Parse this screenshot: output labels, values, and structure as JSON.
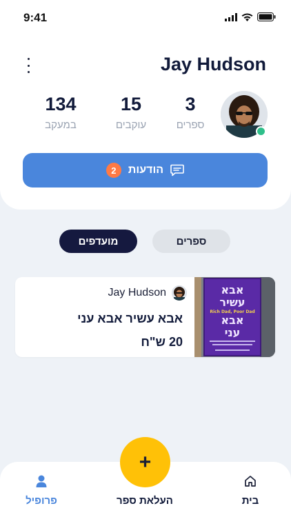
{
  "status_bar": {
    "time": "9:41"
  },
  "profile": {
    "name": "Jay Hudson",
    "stats": [
      {
        "id": "books",
        "value": "3",
        "label": "ספרים"
      },
      {
        "id": "followers",
        "value": "15",
        "label": "עוקבים"
      },
      {
        "id": "following",
        "value": "134",
        "label": "במעקב"
      }
    ],
    "notifications": {
      "label": "הודעות",
      "count": "2"
    }
  },
  "tabs": {
    "books": "ספרים",
    "favorites": "מועדפים",
    "active": "favorites"
  },
  "book": {
    "owner": "Jay Hudson",
    "title": "אבא עשיר אבא עני",
    "price": "20 ש\"ח",
    "cover_title_he": "אבא עשיר אבא עני",
    "cover_title_en": "Rich Dad, Poor Dad"
  },
  "bottom_nav": {
    "home": "בית",
    "upload": "העלאת ספר",
    "profile": "פרופיל",
    "fab_symbol": "+",
    "active": "profile"
  },
  "colors": {
    "accent": "#4a86dc",
    "badge": "#ff7a45",
    "fab": "#ffc107",
    "dark": "#15193f",
    "online": "#2fbf8a"
  }
}
